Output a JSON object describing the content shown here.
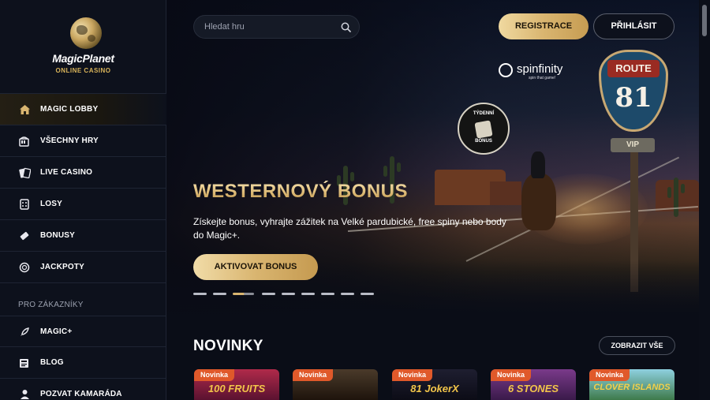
{
  "brand": {
    "name": "MagicPlanet",
    "tagline": "ONLINE CASINO"
  },
  "sidebar": {
    "items": [
      {
        "label": "MAGIC LOBBY",
        "icon": "home-icon",
        "active": true
      },
      {
        "label": "VŠECHNY HRY",
        "icon": "slot-machine-icon"
      },
      {
        "label": "LIVE CASINO",
        "icon": "cards-icon"
      },
      {
        "label": "LOSY",
        "icon": "ticket-icon"
      },
      {
        "label": "BONUSY",
        "icon": "gift-ticket-icon"
      },
      {
        "label": "JACKPOTY",
        "icon": "chip-icon"
      }
    ],
    "section_label": "PRO ZÁKAZNÍKY",
    "customer_items": [
      {
        "label": "MAGIC+",
        "icon": "rocket-icon"
      },
      {
        "label": "BLOG",
        "icon": "newspaper-icon"
      },
      {
        "label": "POZVAT KAMARÁDA",
        "icon": "user-icon"
      }
    ]
  },
  "header": {
    "search_placeholder": "Hledat hru",
    "register_label": "REGISTRACE",
    "login_label": "PŘIHLÁSIT"
  },
  "hero": {
    "provider_name": "spinfinity",
    "provider_tag": "spin that game!",
    "badge_top": "TÝDENNÍ",
    "badge_bottom": "BONUS",
    "route_label": "ROUTE",
    "route_number": "81",
    "vip_label": "VIP",
    "title": "WESTERNOVÝ BONUS",
    "text": "Získejte bonus, vyhrajte zážitek na Velké pardubické, free spiny nebo body do Magic+.",
    "cta_label": "AKTIVOVAT BONUS",
    "slides_total": 10,
    "active_slide": 3
  },
  "novinky": {
    "title": "NOVINKY",
    "view_all_label": "ZOBRAZIT VŠE",
    "games": [
      {
        "tag": "Novinka",
        "name": "100 FRUITS",
        "color": "#7a1d3a"
      },
      {
        "tag": "Novinka",
        "name": "",
        "color": "#3a2a1c"
      },
      {
        "tag": "Novinka",
        "name": "81 JokerX",
        "color": "#1a1a2a"
      },
      {
        "tag": "Novinka",
        "name": "6 STONES",
        "color": "#5a2a5a"
      },
      {
        "tag": "Novinka",
        "name": "CLOVER ISLANDS",
        "color": "#3e6a3a"
      }
    ]
  },
  "colors": {
    "accent_gold": "#d9b570",
    "tag_orange": "#e0592a",
    "background": "#0a0d17"
  }
}
